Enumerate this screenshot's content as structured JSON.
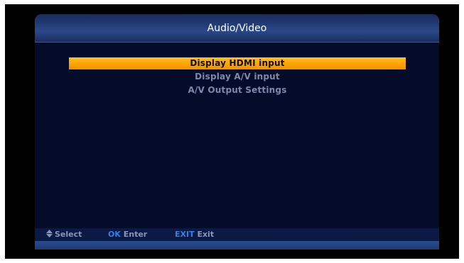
{
  "header": {
    "title": "Audio/Video"
  },
  "menu": {
    "items": [
      {
        "label": "Display HDMI input",
        "selected": true
      },
      {
        "label": "Display A/V input",
        "selected": false
      },
      {
        "label": "A/V Output Settings",
        "selected": false
      }
    ]
  },
  "help": {
    "select": {
      "icon": "up-down-arrows-icon",
      "label": "Select"
    },
    "enter": {
      "key": "OK",
      "label": "Enter"
    },
    "exit": {
      "key": "EXIT",
      "label": "Exit"
    }
  },
  "colors": {
    "highlight": "#ffa400",
    "key_blue": "#3a7be6",
    "panel_bg": "#050c29",
    "title_bar": "#24407c"
  }
}
